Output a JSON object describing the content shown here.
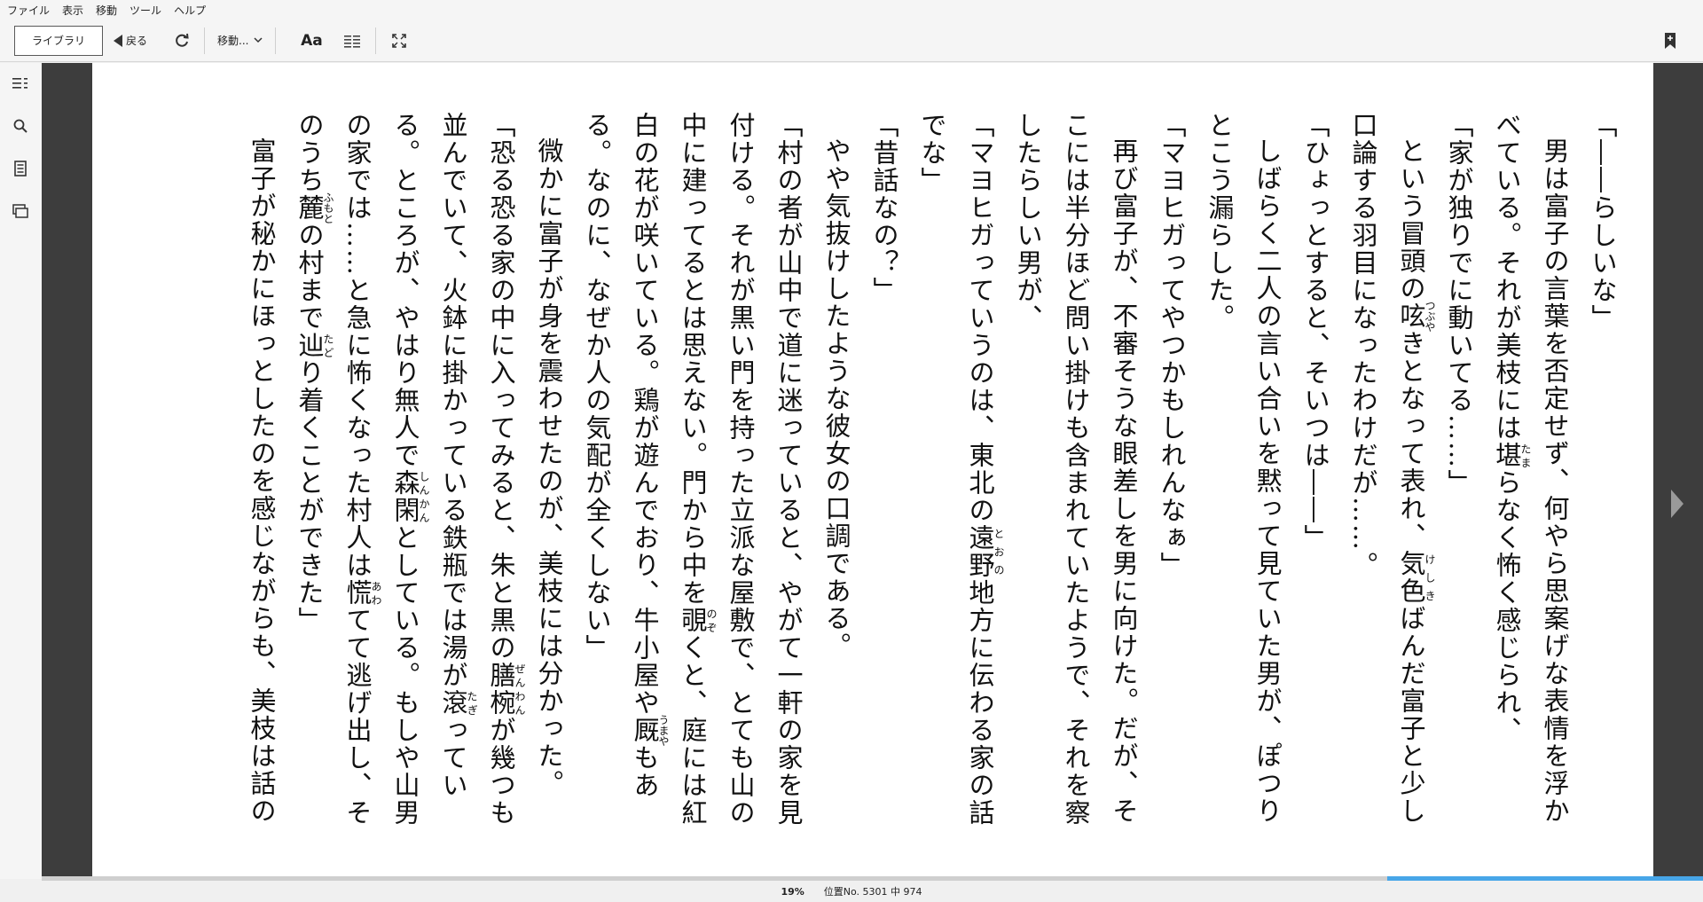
{
  "menu": [
    "ファイル",
    "表示",
    "移動",
    "ツール",
    "ヘルプ"
  ],
  "toolbar": {
    "library_label": "ライブラリ",
    "back_label": "戻る",
    "goto_label": "移動...",
    "font_label": "Aa",
    "icons": [
      "refresh-icon",
      "chevron-down-icon",
      "layout-icon",
      "fullscreen-icon",
      "bookmark-icon"
    ]
  },
  "sidebar": {
    "icons": [
      "toc-icon",
      "search-icon",
      "notes-icon",
      "flashcards-icon"
    ]
  },
  "reader": {
    "paragraphs": [
      {
        "indent": false,
        "text": "「――らしいな」"
      },
      {
        "indent": true,
        "text": "男は富子の言葉を否定せず、何やら思案げな表情を浮かべている。それが美枝には堪らなく怖く感じられ、"
      },
      {
        "indent": false,
        "text": "「家が独りでに動いてる……」"
      },
      {
        "indent": true,
        "text": "という冒頭の呟きとなって表れ、気色ばんだ富子と少し口論する羽目になったわけだが……。"
      },
      {
        "indent": false,
        "text": "「ひょっとすると、そいつは――」"
      },
      {
        "indent": true,
        "text": "しばらく二人の言い合いを黙って見ていた男が、ぽつりとこう漏らした。"
      },
      {
        "indent": false,
        "text": "「マヨヒガってやつかもしれんなぁ」"
      },
      {
        "indent": true,
        "text": "再び富子が、不審そうな眼差しを男に向けた。だが、そこには半分ほど問い掛けも含まれていたようで、それを察したらしい男が、"
      },
      {
        "indent": false,
        "text": "「マヨヒガっていうのは、東北の遠野地方に伝わる家の話でな」"
      },
      {
        "indent": false,
        "text": "「昔話なの？」"
      },
      {
        "indent": true,
        "text": "やや気抜けしたような彼女の口調である。"
      },
      {
        "indent": false,
        "text": "「村の者が山中で道に迷っていると、やがて一軒の家を見付ける。それが黒い門を持った立派な屋敷で、とても山の中に建ってるとは思えない。門から中を覗くと、庭には紅白の花が咲いている。鶏が遊んでおり、牛小屋や厩もある。なのに、なぜか人の気配が全くしない」"
      },
      {
        "indent": true,
        "text": "微かに富子が身を震わせたのが、美枝には分かった。"
      },
      {
        "indent": false,
        "text": "「恐る恐る家の中に入ってみると、朱と黒の膳椀が幾つも並んでいて、火鉢に掛かっている鉄瓶では湯が滾っている。ところが、やはり無人で森閑としている。もしや山男の家では……と急に怖くなった村人は慌てて逃げ出し、そのうち麓の村まで辿り着くことができた」"
      },
      {
        "indent": true,
        "text": "富子が秘かにほっとしたのを感じながらも、美枝は話の"
      }
    ]
  },
  "ruby": [
    {
      "base": "堪",
      "reading": "たま"
    },
    {
      "base": "呟",
      "reading": "つぶや"
    },
    {
      "base": "気色",
      "reading": "けしき"
    },
    {
      "base": "遠野",
      "reading": "とおの"
    },
    {
      "base": "覗",
      "reading": "のぞ"
    },
    {
      "base": "厩",
      "reading": "うまや"
    },
    {
      "base": "膳椀",
      "reading": "ぜんわん"
    },
    {
      "base": "滾",
      "reading": "たぎ"
    },
    {
      "base": "森閑",
      "reading": "しんかん"
    },
    {
      "base": "慌",
      "reading": "あわ"
    },
    {
      "base": "麓",
      "reading": "ふもと"
    },
    {
      "base": "辿",
      "reading": "たど"
    }
  ],
  "status": {
    "percent": "19%",
    "location": "位置No. 5301 中 974",
    "progress": 0.19
  }
}
